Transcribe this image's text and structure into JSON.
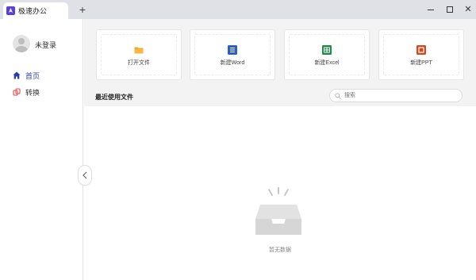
{
  "titlebar": {
    "tab_title": "极速办公",
    "new_tab_label": "+",
    "minimize_icon": "minimize-icon",
    "maximize_icon": "maximize-icon",
    "close_label": "✕"
  },
  "sidebar": {
    "username": "未登录",
    "nav": [
      {
        "label": "首页",
        "icon": "home-icon",
        "active": true
      },
      {
        "label": "转换",
        "icon": "convert-icon",
        "active": false
      }
    ],
    "collapse_icon": "chevron-left-icon"
  },
  "actions": [
    {
      "label": "打开文件",
      "icon": "folder-icon",
      "color": "#f5a623"
    },
    {
      "label": "新建Word",
      "icon": "word-icon",
      "color": "#2b5cc8"
    },
    {
      "label": "新建Excel",
      "icon": "excel-icon",
      "color": "#1e8a45"
    },
    {
      "label": "新建PPT",
      "icon": "ppt-icon",
      "color": "#d04a20"
    }
  ],
  "recent": {
    "title": "最近使用文件",
    "search_placeholder": "搜索",
    "empty_text": "暂无数据"
  },
  "colors": {
    "accent": "#2b3ea6",
    "titlebar_bg": "#dfe1e6",
    "top_area_bg": "#f3f3f4"
  }
}
